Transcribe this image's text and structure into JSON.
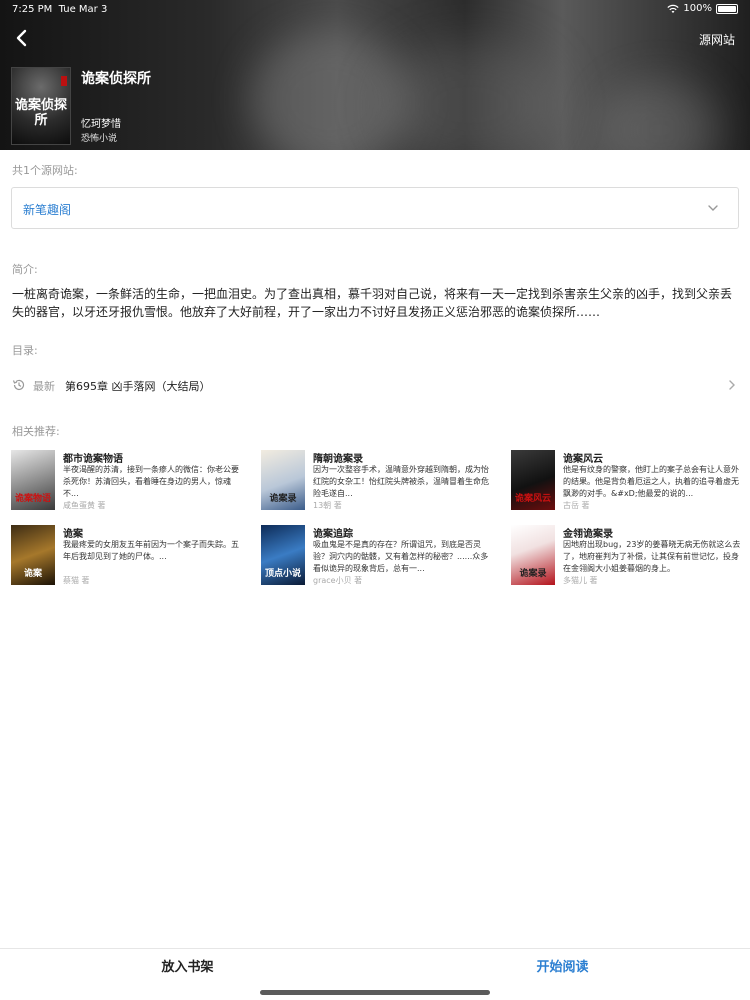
{
  "status_bar": {
    "time": "7:25 PM",
    "date": "Tue Mar 3",
    "battery": "100%"
  },
  "header": {
    "source_link": "源网站",
    "book": {
      "title": "诡案侦探所",
      "author": "忆珂梦惜",
      "category": "恐怖小说",
      "cover_art_text": "诡案侦探所"
    }
  },
  "sources": {
    "label": "共1个源网站:",
    "selected": "新笔趣阁"
  },
  "intro": {
    "label": "简介:",
    "text": "一桩离奇诡案，一条鲜活的生命，一把血泪史。为了查出真相，慕千羽对自己说，将来有一天一定找到杀害亲生父亲的凶手，找到父亲丢失的器官，以牙还牙报仇雪恨。他放弃了大好前程，开了一家出力不讨好且发扬正义惩治邪恶的诡案侦探所……"
  },
  "toc": {
    "label": "目录:",
    "latest_label": "最新",
    "latest_chapter": "第695章 凶手落网（大结局）"
  },
  "recommend": {
    "label": "相关推荐:",
    "items": [
      {
        "title": "都市诡案物语",
        "desc": "半夜渴醒的苏清，接到一条瘆人的微信：你老公要杀死你！苏清回头，看着睡在身边的男人，惊魂不...",
        "author": "咸鱼蛋黄 著",
        "cover_text": "诡案物语"
      },
      {
        "title": "隋朝诡案录",
        "desc": "因为一次整容手术，温晴意外穿越到隋朝，成为怡红院的女杂工！怡红院头牌被杀，温晴冒着生命危险毛遂自...",
        "author": "13朝 著",
        "cover_text": "诡案录"
      },
      {
        "title": "诡案风云",
        "desc": "他是有纹身的警察，他盯上的案子总会有让人意外的结果。他是背负着厄运之人，执着的追寻着虚无飘渺的对手。&#xD;他最爱的说的...",
        "author": "古岳 著",
        "cover_text": "诡案风云"
      },
      {
        "title": "诡案",
        "desc": "我最疼爱的女朋友五年前因为一个案子而失踪。五年后我却见到了她的尸体。...",
        "author": "蔡猫 著",
        "cover_text": "诡案"
      },
      {
        "title": "诡案追踪",
        "desc": "吸血鬼是不是真的存在？所谓诅咒，到底是否灵验？洞穴内的骷髅，又有着怎样的秘密？......众多看似诡异的现象背后，总有一...",
        "author": "grace小贝 著",
        "cover_text": "顶点小说"
      },
      {
        "title": "金翎诡案录",
        "desc": "因地府出现bug，23岁的姜暮晓无病无伤就这么去了，地府崔判为了补偿，让其保有前世记忆，投身在金翎阁大小姐姜暮烟的身上。",
        "author": "多猫儿 著",
        "cover_text": "诡案录"
      }
    ]
  },
  "bottom_bar": {
    "add_shelf": "放入书架",
    "start_reading": "开始阅读"
  }
}
